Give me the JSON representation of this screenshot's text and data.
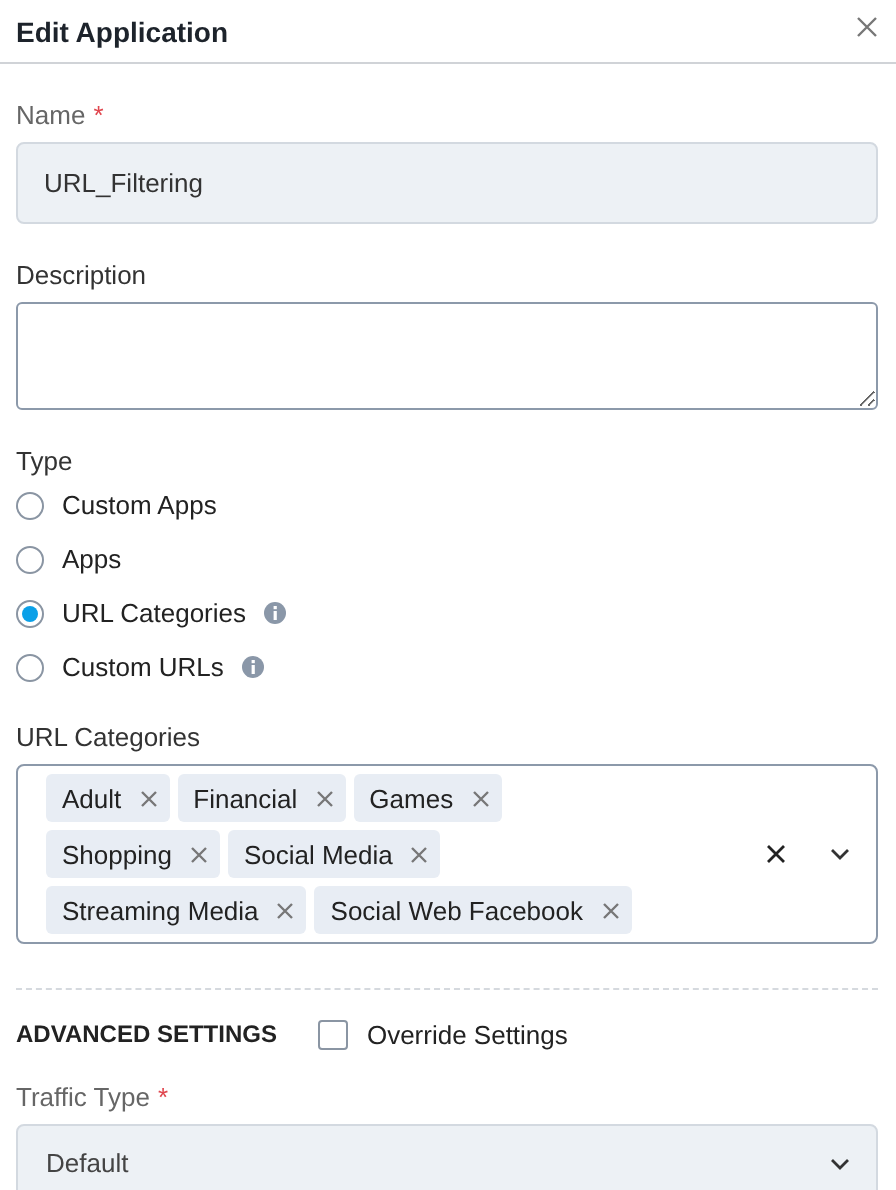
{
  "dialog": {
    "title": "Edit Application"
  },
  "name_field": {
    "label": "Name",
    "required_mark": "*",
    "value": "URL_Filtering"
  },
  "description_field": {
    "label": "Description"
  },
  "type": {
    "label": "Type",
    "options": [
      {
        "label": "Custom Apps",
        "selected": false,
        "info": false
      },
      {
        "label": "Apps",
        "selected": false,
        "info": false
      },
      {
        "label": "URL Categories",
        "selected": true,
        "info": true
      },
      {
        "label": "Custom URLs",
        "selected": false,
        "info": true
      }
    ]
  },
  "url_categories": {
    "label": "URL Categories",
    "tags": [
      "Adult",
      "Financial",
      "Games",
      "Shopping",
      "Social Media",
      "Streaming Media",
      "Social Web Facebook"
    ]
  },
  "advanced_settings": {
    "heading": "ADVANCED SETTINGS",
    "override": {
      "label": "Override Settings",
      "checked": false
    }
  },
  "traffic_type": {
    "label": "Traffic Type",
    "required_mark": "*",
    "value": "Default"
  }
}
